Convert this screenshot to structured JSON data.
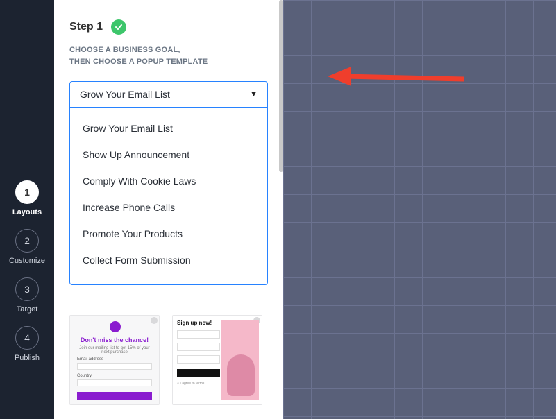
{
  "sidebar": {
    "steps": [
      {
        "num": "1",
        "label": "Layouts"
      },
      {
        "num": "2",
        "label": "Customize"
      },
      {
        "num": "3",
        "label": "Target"
      },
      {
        "num": "4",
        "label": "Publish"
      }
    ],
    "active_index": 0
  },
  "panel": {
    "step_label": "Step 1",
    "subtitle_line1": "CHOOSE A BUSINESS GOAL,",
    "subtitle_line2": "THEN CHOOSE A POPUP TEMPLATE",
    "select": {
      "value": "Grow Your Email List",
      "options": [
        "Grow Your Email List",
        "Show Up Announcement",
        "Comply With Cookie Laws",
        "Increase Phone Calls",
        "Promote Your Products",
        "Collect Form Submission"
      ]
    },
    "templates": {
      "tpl3_heading": "Don't miss the chance!",
      "tpl3_sub": "Join our mailing list to get 15% of your next purchase",
      "tpl4_title": "Sign up now!"
    }
  },
  "annotation": {
    "arrow_color": "#ef3e2c"
  }
}
